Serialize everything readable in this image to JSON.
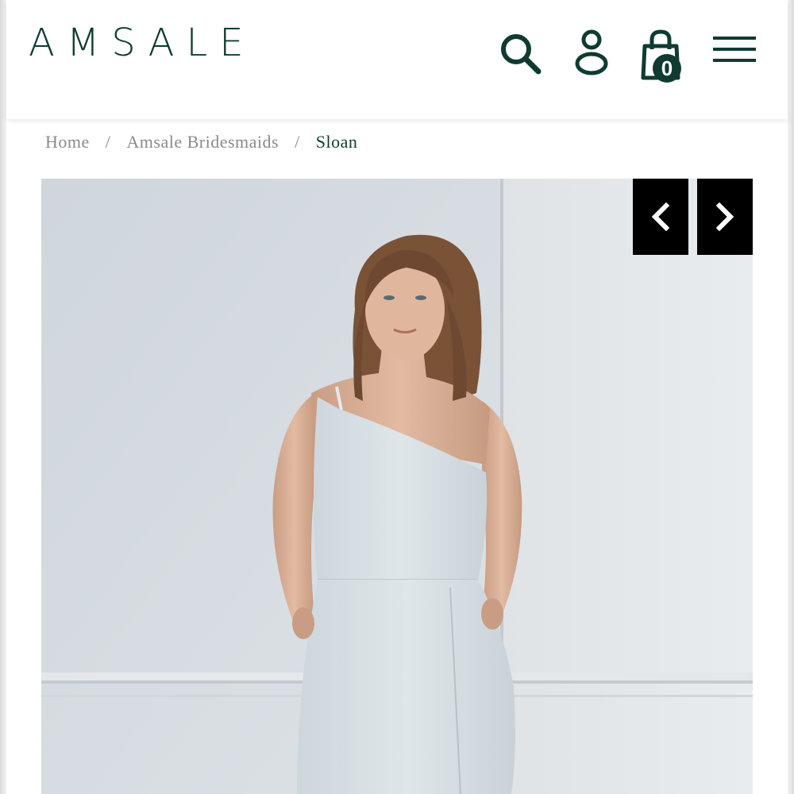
{
  "header": {
    "logo_text": "AMSALE",
    "cart_count": "0",
    "icons": [
      "search-icon",
      "account-icon",
      "shopping-bag-icon",
      "hamburger-menu-icon"
    ],
    "brand_color": "#0f3b31"
  },
  "breadcrumb": {
    "items": [
      "Home",
      "Amsale Bridesmaids",
      "Sloan"
    ],
    "separator": "/"
  },
  "gallery": {
    "prev_icon": "chevron-left-icon",
    "next_icon": "chevron-right-icon",
    "image_alt": "Model wearing the Sloan one-shoulder white dress"
  }
}
